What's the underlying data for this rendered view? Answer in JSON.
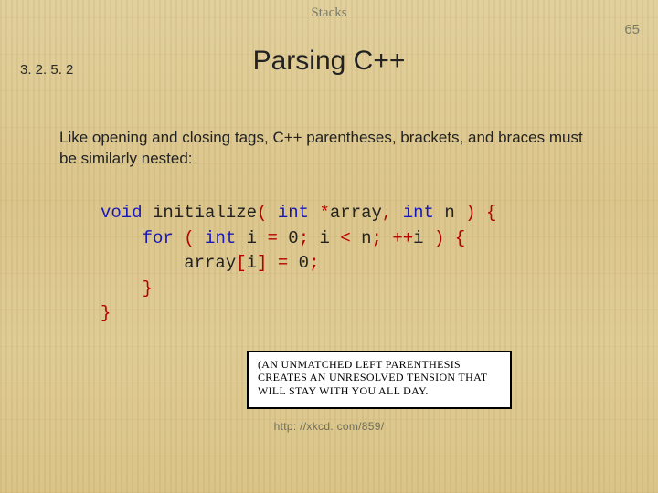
{
  "header": {
    "topic": "Stacks"
  },
  "page": {
    "number": "65",
    "section": "3. 2. 5. 2"
  },
  "title": "Parsing C++",
  "body": "Like opening and closing tags, C++ parentheses, brackets, and braces must be similarly nested:",
  "code": {
    "t": {
      "void": "void",
      "initialize": "initialize",
      "int": "int",
      "array": "array",
      "n": "n",
      "for": "for",
      "i": "i",
      "star": "*",
      "comma": ",",
      "lp": "(",
      "rp": ")",
      "lb": "{",
      "rb": "}",
      "ls": "[",
      "rs": "]",
      "eq": "=",
      "semi": ";",
      "lt": "<",
      "pp": "++",
      "zero": "0"
    }
  },
  "comic": {
    "text": "(An unmatched left parenthesis creates an unresolved tension that will stay with you all day."
  },
  "citation": "http: //xkcd. com/859/"
}
